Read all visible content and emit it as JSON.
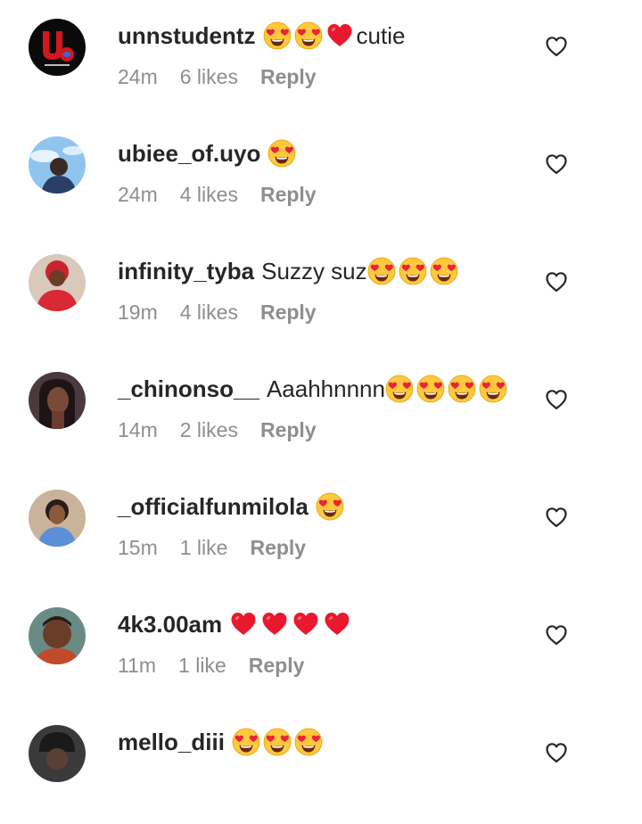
{
  "comments": [
    {
      "username": "unnstudentz",
      "emojis": [
        "heart-eyes",
        "heart-eyes",
        "red-heart"
      ],
      "text": "cutie",
      "time": "24m",
      "likes": "6 likes",
      "reply": "Reply",
      "avatar": "unnstudentz-logo"
    },
    {
      "username": "ubiee_of.uyo",
      "emojis": [
        "heart-eyes"
      ],
      "text": "",
      "time": "24m",
      "likes": "4 likes",
      "reply": "Reply",
      "avatar": "person-sky"
    },
    {
      "username": "infinity_tyba",
      "emojis": [
        "heart-eyes",
        "heart-eyes",
        "heart-eyes"
      ],
      "text": "Suzzy suz",
      "text_first": true,
      "time": "19m",
      "likes": "4 likes",
      "reply": "Reply",
      "avatar": "person-red"
    },
    {
      "username": "_chinonso__",
      "emojis": [
        "heart-eyes",
        "heart-eyes",
        "heart-eyes",
        "heart-eyes"
      ],
      "text": "Aaahhnnnn",
      "text_first": true,
      "time": "14m",
      "likes": "2 likes",
      "reply": "Reply",
      "avatar": "person-dark"
    },
    {
      "username": "_officialfunmilola",
      "emojis": [
        "heart-eyes"
      ],
      "text": "",
      "time": "15m",
      "likes": "1 like",
      "reply": "Reply",
      "avatar": "person-light"
    },
    {
      "username": "4k3.00am",
      "emojis": [
        "red-heart",
        "red-heart",
        "red-heart",
        "red-heart"
      ],
      "text": "",
      "time": "11m",
      "likes": "1 like",
      "reply": "Reply",
      "avatar": "person-brown"
    },
    {
      "username": "mello_diii",
      "emojis": [
        "heart-eyes",
        "heart-eyes",
        "heart-eyes"
      ],
      "text": "",
      "time": "",
      "likes": "",
      "reply": "",
      "avatar": "person-hat"
    }
  ],
  "icons": {
    "like_button": "heart-outline-icon"
  },
  "colors": {
    "text": "#262626",
    "meta": "#8e8e8e",
    "heart": "#ed2a3c",
    "emoji_face": "#ffc83d"
  }
}
